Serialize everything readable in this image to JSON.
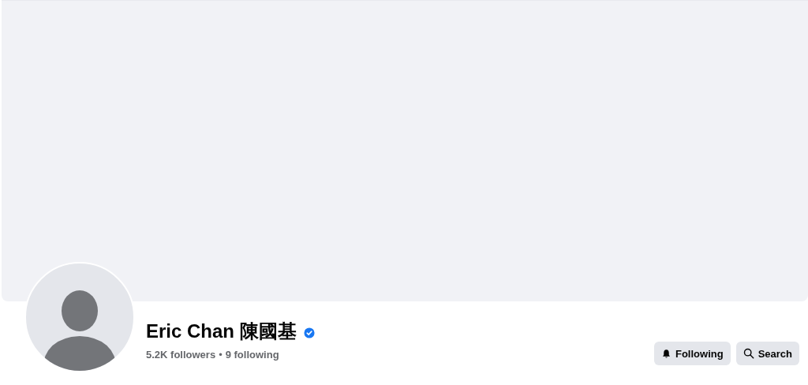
{
  "profile": {
    "name": "Eric Chan 陳國基",
    "verified": true,
    "followers": "5.2K followers",
    "separator": "•",
    "following": "9 following"
  },
  "buttons": [
    {
      "kind": "following",
      "label": "Following"
    },
    {
      "kind": "search",
      "label": "Search"
    }
  ]
}
